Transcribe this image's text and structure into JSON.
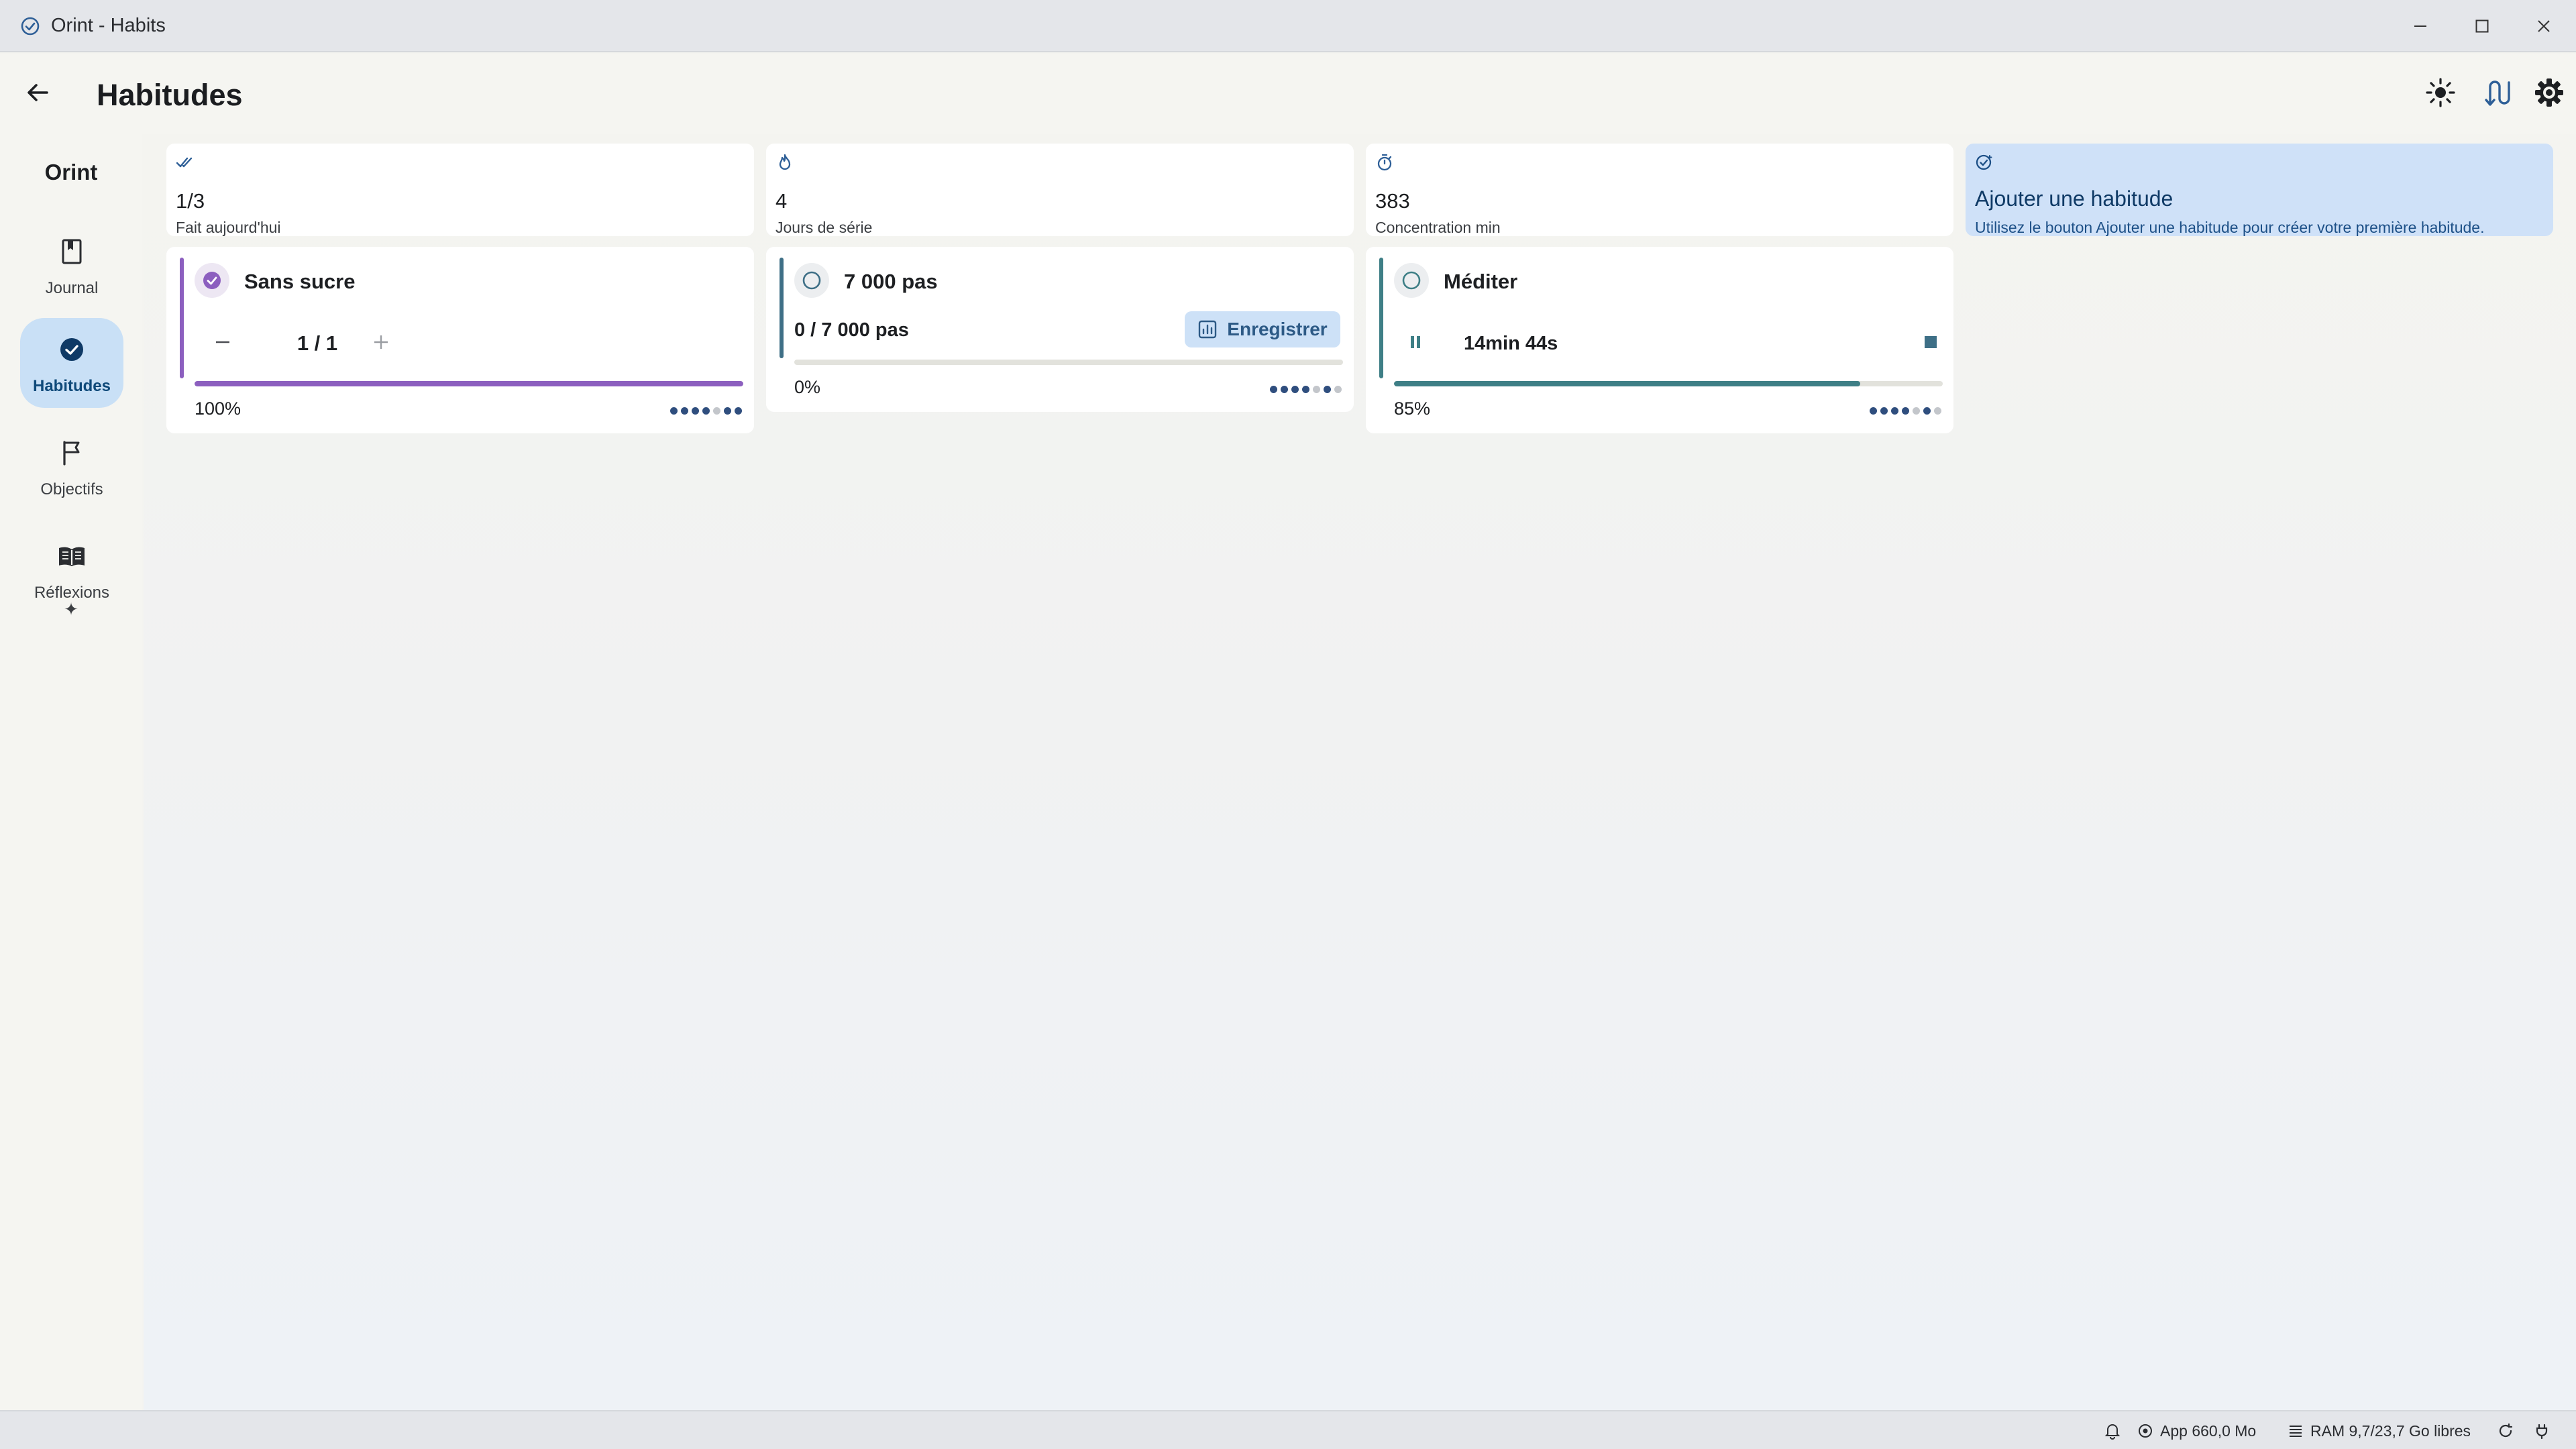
{
  "window": {
    "title": "Orint - Habits"
  },
  "header": {
    "title": "Habitudes"
  },
  "sidebar": {
    "brand": "Orint",
    "items": [
      {
        "label": "Journal",
        "icon": "bookmark-icon",
        "active": false
      },
      {
        "label": "Habitudes",
        "icon": "check-circle-icon",
        "active": true
      },
      {
        "label": "Objectifs",
        "icon": "flag-icon",
        "active": false
      },
      {
        "label": "Réflexions",
        "icon": "open-book-icon",
        "active": false
      }
    ],
    "sparkle": "✦"
  },
  "stats": [
    {
      "value": "1/3",
      "label": "Fait aujourd'hui",
      "icon": "double-check-icon"
    },
    {
      "value": "4",
      "label": "Jours de série",
      "icon": "flame-icon"
    },
    {
      "value": "383",
      "label": "Concentration min",
      "icon": "timer-icon"
    }
  ],
  "add_card": {
    "title": "Ajouter une habitude",
    "subtitle": "Utilisez le bouton Ajouter une habitude pour créer votre première habitude.",
    "icon": "check-plus-icon"
  },
  "habits": [
    {
      "name": "Sans sucre",
      "stepper_value": "1 / 1",
      "percent_label": "100%",
      "progress": 1.0,
      "accent": "#8c5fbf",
      "dots": [
        1,
        1,
        1,
        1,
        0,
        1,
        1
      ]
    },
    {
      "name": "7 000 pas",
      "progress_text": "0 / 7 000 pas",
      "record_label": "Enregistrer",
      "percent_label": "0%",
      "progress": 0.0,
      "accent": "#3e6f86",
      "dots": [
        1,
        1,
        1,
        1,
        0,
        1,
        0
      ]
    },
    {
      "name": "Méditer",
      "timer": "14min 44s",
      "percent_label": "85%",
      "progress": 0.85,
      "accent": "#3e7f86",
      "dots": [
        1,
        1,
        1,
        1,
        0,
        1,
        0
      ]
    }
  ],
  "statusbar": {
    "app_memory": "App 660,0 Mo",
    "ram": "RAM 9,7/23,7 Go libres"
  },
  "colors": {
    "accent_blue": "#cde1f7",
    "purple": "#8c5fbf",
    "teal": "#3e7f86",
    "dot": "#2f4e7e"
  }
}
